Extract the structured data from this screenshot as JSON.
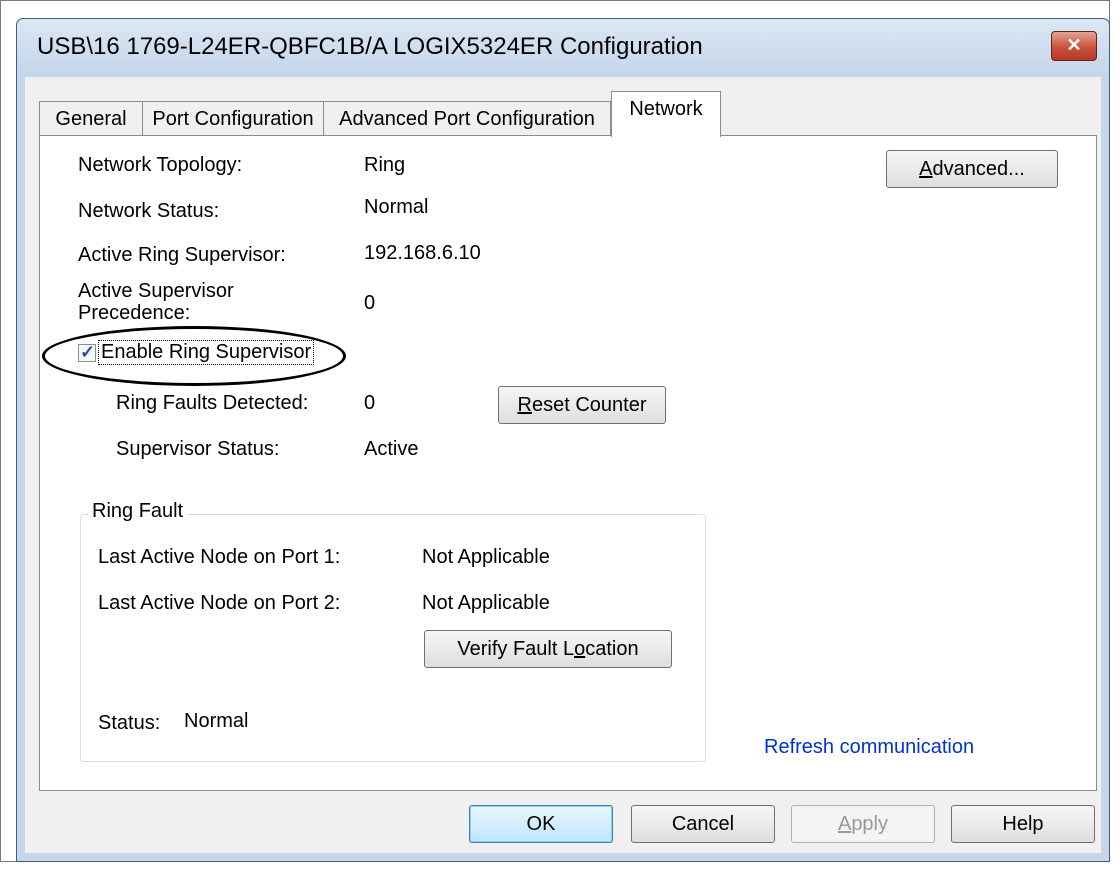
{
  "window": {
    "title": "USB\\16 1769-L24ER-QBFC1B/A LOGIX5324ER Configuration",
    "close_glyph": "✕"
  },
  "tabs": [
    {
      "label": "General"
    },
    {
      "label": "Port Configuration"
    },
    {
      "label": "Advanced Port Configuration"
    },
    {
      "label": "Network"
    }
  ],
  "network": {
    "topology_label": "Network Topology:",
    "topology_value": "Ring",
    "status_label": "Network Status:",
    "status_value": "Normal",
    "supervisor_label": "Active Ring Supervisor:",
    "supervisor_value": "192.168.6.10",
    "precedence_label_1": "Active Supervisor",
    "precedence_label_2": "Precedence:",
    "precedence_value": "0",
    "advanced_button": {
      "pre": "",
      "accel": "A",
      "post": "dvanced..."
    }
  },
  "supervisor": {
    "enable_checkbox_label": "Enable Ring Supervisor",
    "enable_checked": true,
    "faults_label": "Ring Faults Detected:",
    "faults_value": "0",
    "reset_button": {
      "pre": "",
      "accel": "R",
      "post": "eset Counter"
    },
    "status_label": "Supervisor Status:",
    "status_value": "Active"
  },
  "ring_fault": {
    "title": "Ring Fault",
    "port1_label": "Last Active Node on Port 1:",
    "port1_value": "Not Applicable",
    "port2_label": "Last Active Node on Port 2:",
    "port2_value": "Not Applicable",
    "verify_button": {
      "pre": "Verify Fault L",
      "accel": "o",
      "post": "cation"
    },
    "status_label": "Status:",
    "status_value": "Normal"
  },
  "refresh_link": "Refresh communication",
  "footer": {
    "ok": "OK",
    "cancel": "Cancel",
    "apply": {
      "pre": "",
      "accel": "A",
      "post": "pply"
    },
    "help": "Help"
  }
}
